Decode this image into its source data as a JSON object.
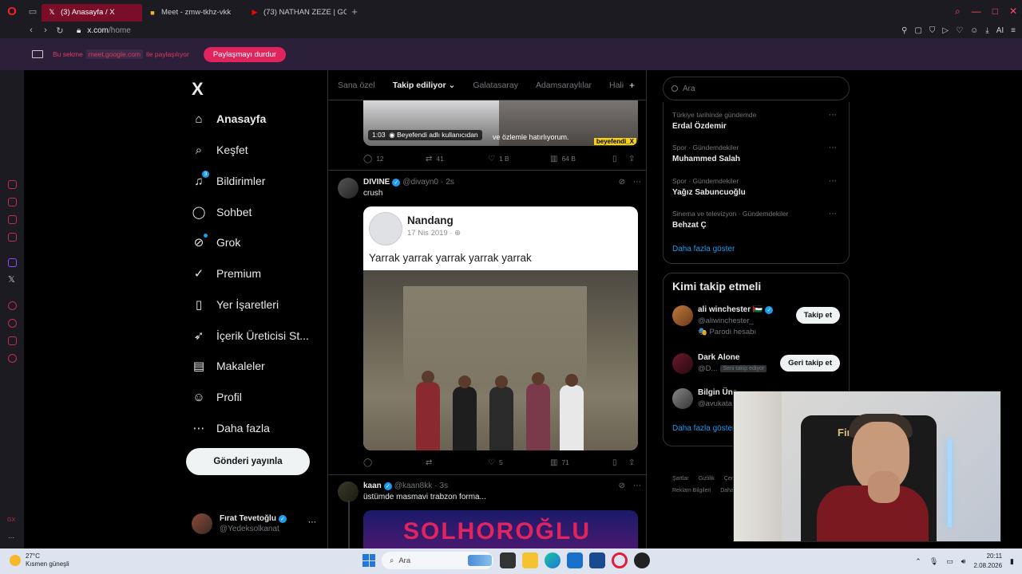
{
  "browser": {
    "tabs": [
      {
        "label": "(3) Anasayfa / X",
        "active": true
      },
      {
        "label": "Meet - zmw-tkhz-vkk",
        "active": false
      },
      {
        "label": "(73) NATHAN ZEZE | GOLC",
        "active": false
      }
    ],
    "url_host": "x.com",
    "url_path": "/home"
  },
  "sharebar": {
    "pre": "Bu sekme",
    "host": "meet.google.com",
    "post": "ile paylaşılıyor",
    "stop_label": "Paylaşmayı durdur"
  },
  "nav": {
    "logo": "X",
    "items": [
      {
        "label": "Anasayfa",
        "icon": "home-icon",
        "glyph": "⌂"
      },
      {
        "label": "Keşfet",
        "icon": "search-icon",
        "glyph": "⌕"
      },
      {
        "label": "Bildirimler",
        "icon": "bell-icon",
        "glyph": "🔔",
        "badge": "3"
      },
      {
        "label": "Sohbet",
        "icon": "chat-icon",
        "glyph": "○"
      },
      {
        "label": "Grok",
        "icon": "grok-icon",
        "glyph": "⊘"
      },
      {
        "label": "Premium",
        "icon": "premium-icon",
        "glyph": "✓"
      },
      {
        "label": "Yer İşaretleri",
        "icon": "bookmark-icon",
        "glyph": "▯"
      },
      {
        "label": "İçerik Üreticisi St...",
        "icon": "rocket-icon",
        "glyph": "➶"
      },
      {
        "label": "Makaleler",
        "icon": "articles-icon",
        "glyph": "▤"
      },
      {
        "label": "Profil",
        "icon": "profile-icon",
        "glyph": "⚲"
      },
      {
        "label": "Daha fazla",
        "icon": "more-icon",
        "glyph": "⋯"
      }
    ],
    "post_label": "Gönderi yayınla",
    "me": {
      "name": "Fırat Tevetoğlu",
      "handle": "@Yedeksolkanat"
    }
  },
  "timeline": {
    "tabs": [
      "Sana özel",
      "Takip ediliyor",
      "Galatasaray",
      "Adamsaraylılar",
      "Hali"
    ],
    "video": {
      "time": "1:03",
      "attribution": "Beyefendi adlı kullanıcıdan",
      "subtitle": "ve özlemle hatırlıyorum.",
      "tag": "beyefendi_X"
    },
    "post0_actions": {
      "replies": "12",
      "reposts": "41",
      "likes": "1 B",
      "views": "64 B"
    },
    "post1": {
      "name": "DIVINE",
      "handle": "@divayn0",
      "time": "2s",
      "text": "crush",
      "card": {
        "name": "Nandang",
        "date": "17 Nis 2019 ·",
        "text": "Yarrak yarrak yarrak yarrak yarrak"
      },
      "actions": {
        "replies": "",
        "reposts": "",
        "likes": "5",
        "views": "71"
      }
    },
    "post2": {
      "name": "kaan",
      "handle": "@kaan8kk",
      "time": "3s",
      "text": "üstümde masmavi trabzon forma...",
      "media_text": "SOLHOROĞLU"
    }
  },
  "right": {
    "search_placeholder": "Ara",
    "trends": [
      {
        "category": "Türkiye tarihinde gündemde",
        "title": "Erdal Özdemir"
      },
      {
        "category": "Spor · Gündemdekiler",
        "title": "Muhammed Salah"
      },
      {
        "category": "Spor · Gündemdekiler",
        "title": "Yağız Sabuncuoğlu"
      },
      {
        "category": "Sinema ve televizyon · Gündemdekiler",
        "title": "Behzat Ç"
      }
    ],
    "show_more": "Daha fazla göster",
    "who_to_follow_title": "Kimi takip etmeli",
    "follow": [
      {
        "name": "ali winchester 🇵🇸",
        "handle": "@aliwinchester_",
        "extra": "🎭 Parodi hesabı",
        "button": "Takip et"
      },
      {
        "name": "Dark Alone",
        "handle": "@D...",
        "tag": "Seni takip ediyor",
        "button": "Geri takip et"
      },
      {
        "name": "Bilgin Üns",
        "handle": "@avukata"
      }
    ],
    "show_more2": "Daha fazla göster",
    "footer": [
      "Şartlar",
      "Gizlilik",
      "Çerez",
      "Reklam Bilgileri",
      "Daha"
    ]
  },
  "webcam": {
    "chair_text": "Firat"
  },
  "taskbar": {
    "weather_temp": "27°C",
    "weather_desc": "Kısmen güneşli",
    "search_placeholder": "Ara",
    "time": "20:11",
    "date": "2.08.2026"
  }
}
